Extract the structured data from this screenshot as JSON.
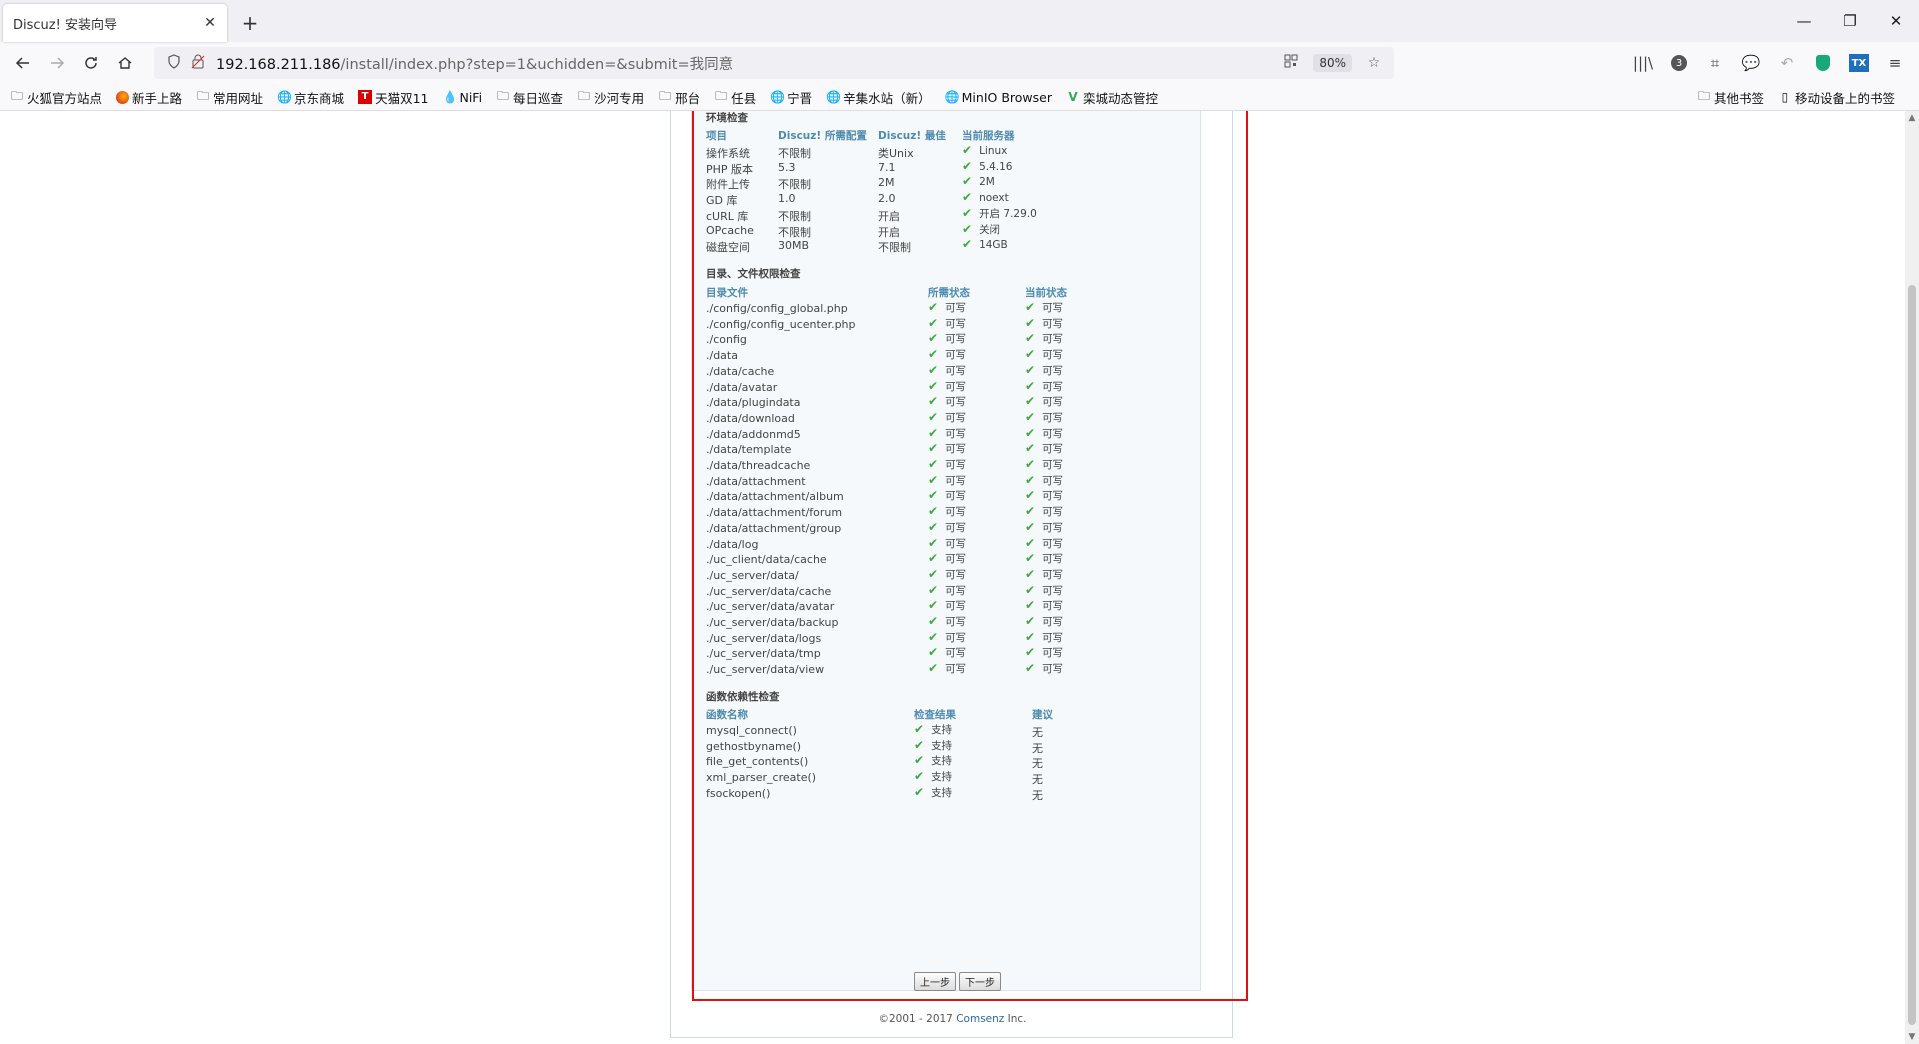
{
  "browser": {
    "tab_title": "Discuz! 安装向导",
    "tab_close": "✕",
    "new_tab": "+",
    "url_host": "192.168.211.186",
    "url_path": "/install/index.php?step=1&uchidden=&submit=我同意",
    "zoom": "80%",
    "badge_count": "3",
    "tx_label": "TX",
    "window": {
      "minimize": "—",
      "restore": "❐",
      "close": "✕"
    }
  },
  "bookmarks": {
    "items": [
      {
        "label": "火狐官方站点",
        "icon": "folder-icon"
      },
      {
        "label": "新手上路",
        "icon": "firefox-icon"
      },
      {
        "label": "常用网址",
        "icon": "folder-icon"
      },
      {
        "label": "京东商城",
        "icon": "globe-icon"
      },
      {
        "label": "天猫双11",
        "icon": "tmall-icon"
      },
      {
        "label": "NiFi",
        "icon": "nifi-icon"
      },
      {
        "label": "每日巡查",
        "icon": "folder-icon"
      },
      {
        "label": "沙河专用",
        "icon": "folder-icon"
      },
      {
        "label": "邢台",
        "icon": "folder-icon"
      },
      {
        "label": "任县",
        "icon": "folder-icon"
      },
      {
        "label": "宁晋",
        "icon": "globe-icon"
      },
      {
        "label": "辛集水站（新）",
        "icon": "globe-icon"
      },
      {
        "label": "MinIO Browser",
        "icon": "globe-icon"
      },
      {
        "label": "栾城动态管控",
        "icon": "vue-icon"
      }
    ],
    "right": [
      {
        "label": "其他书签",
        "icon": "folder-icon"
      },
      {
        "label": "移动设备上的书签",
        "icon": "mobile-icon"
      }
    ]
  },
  "env": {
    "title": "环境检查",
    "headers": [
      "项目",
      "Discuz! 所需配置",
      "Discuz! 最佳",
      "当前服务器"
    ],
    "rows": [
      [
        "操作系统",
        "不限制",
        "类Unix",
        "Linux"
      ],
      [
        "PHP 版本",
        "5.3",
        "7.1",
        "5.4.16"
      ],
      [
        "附件上传",
        "不限制",
        "2M",
        "2M"
      ],
      [
        "GD 库",
        "1.0",
        "2.0",
        "noext"
      ],
      [
        "cURL 库",
        "不限制",
        "开启",
        "开启 7.29.0"
      ],
      [
        "OPcache",
        "不限制",
        "开启",
        "关闭"
      ],
      [
        "磁盘空间",
        "30MB",
        "不限制",
        "14GB"
      ]
    ]
  },
  "dirs": {
    "title": "目录、文件权限检查",
    "headers": [
      "目录文件",
      "所需状态",
      "当前状态"
    ],
    "rows": [
      [
        "./config/config_global.php",
        "可写",
        "可写"
      ],
      [
        "./config/config_ucenter.php",
        "可写",
        "可写"
      ],
      [
        "./config",
        "可写",
        "可写"
      ],
      [
        "./data",
        "可写",
        "可写"
      ],
      [
        "./data/cache",
        "可写",
        "可写"
      ],
      [
        "./data/avatar",
        "可写",
        "可写"
      ],
      [
        "./data/plugindata",
        "可写",
        "可写"
      ],
      [
        "./data/download",
        "可写",
        "可写"
      ],
      [
        "./data/addonmd5",
        "可写",
        "可写"
      ],
      [
        "./data/template",
        "可写",
        "可写"
      ],
      [
        "./data/threadcache",
        "可写",
        "可写"
      ],
      [
        "./data/attachment",
        "可写",
        "可写"
      ],
      [
        "./data/attachment/album",
        "可写",
        "可写"
      ],
      [
        "./data/attachment/forum",
        "可写",
        "可写"
      ],
      [
        "./data/attachment/group",
        "可写",
        "可写"
      ],
      [
        "./data/log",
        "可写",
        "可写"
      ],
      [
        "./uc_client/data/cache",
        "可写",
        "可写"
      ],
      [
        "./uc_server/data/",
        "可写",
        "可写"
      ],
      [
        "./uc_server/data/cache",
        "可写",
        "可写"
      ],
      [
        "./uc_server/data/avatar",
        "可写",
        "可写"
      ],
      [
        "./uc_server/data/backup",
        "可写",
        "可写"
      ],
      [
        "./uc_server/data/logs",
        "可写",
        "可写"
      ],
      [
        "./uc_server/data/tmp",
        "可写",
        "可写"
      ],
      [
        "./uc_server/data/view",
        "可写",
        "可写"
      ]
    ]
  },
  "funcs": {
    "title": "函数依赖性检查",
    "headers": [
      "函数名称",
      "检查结果",
      "建议"
    ],
    "rows": [
      [
        "mysql_connect()",
        "支持",
        "无"
      ],
      [
        "gethostbyname()",
        "支持",
        "无"
      ],
      [
        "file_get_contents()",
        "支持",
        "无"
      ],
      [
        "xml_parser_create()",
        "支持",
        "无"
      ],
      [
        "fsockopen()",
        "支持",
        "无"
      ]
    ]
  },
  "buttons": {
    "prev": "上一步",
    "next": "下一步"
  },
  "footer": {
    "copyright": "©2001 - 2017",
    "brand": "Comsenz",
    "suffix": "Inc."
  },
  "colors": {
    "check": "#3fa93f",
    "header": "#4f8bb0",
    "highlight": "#e01010"
  }
}
